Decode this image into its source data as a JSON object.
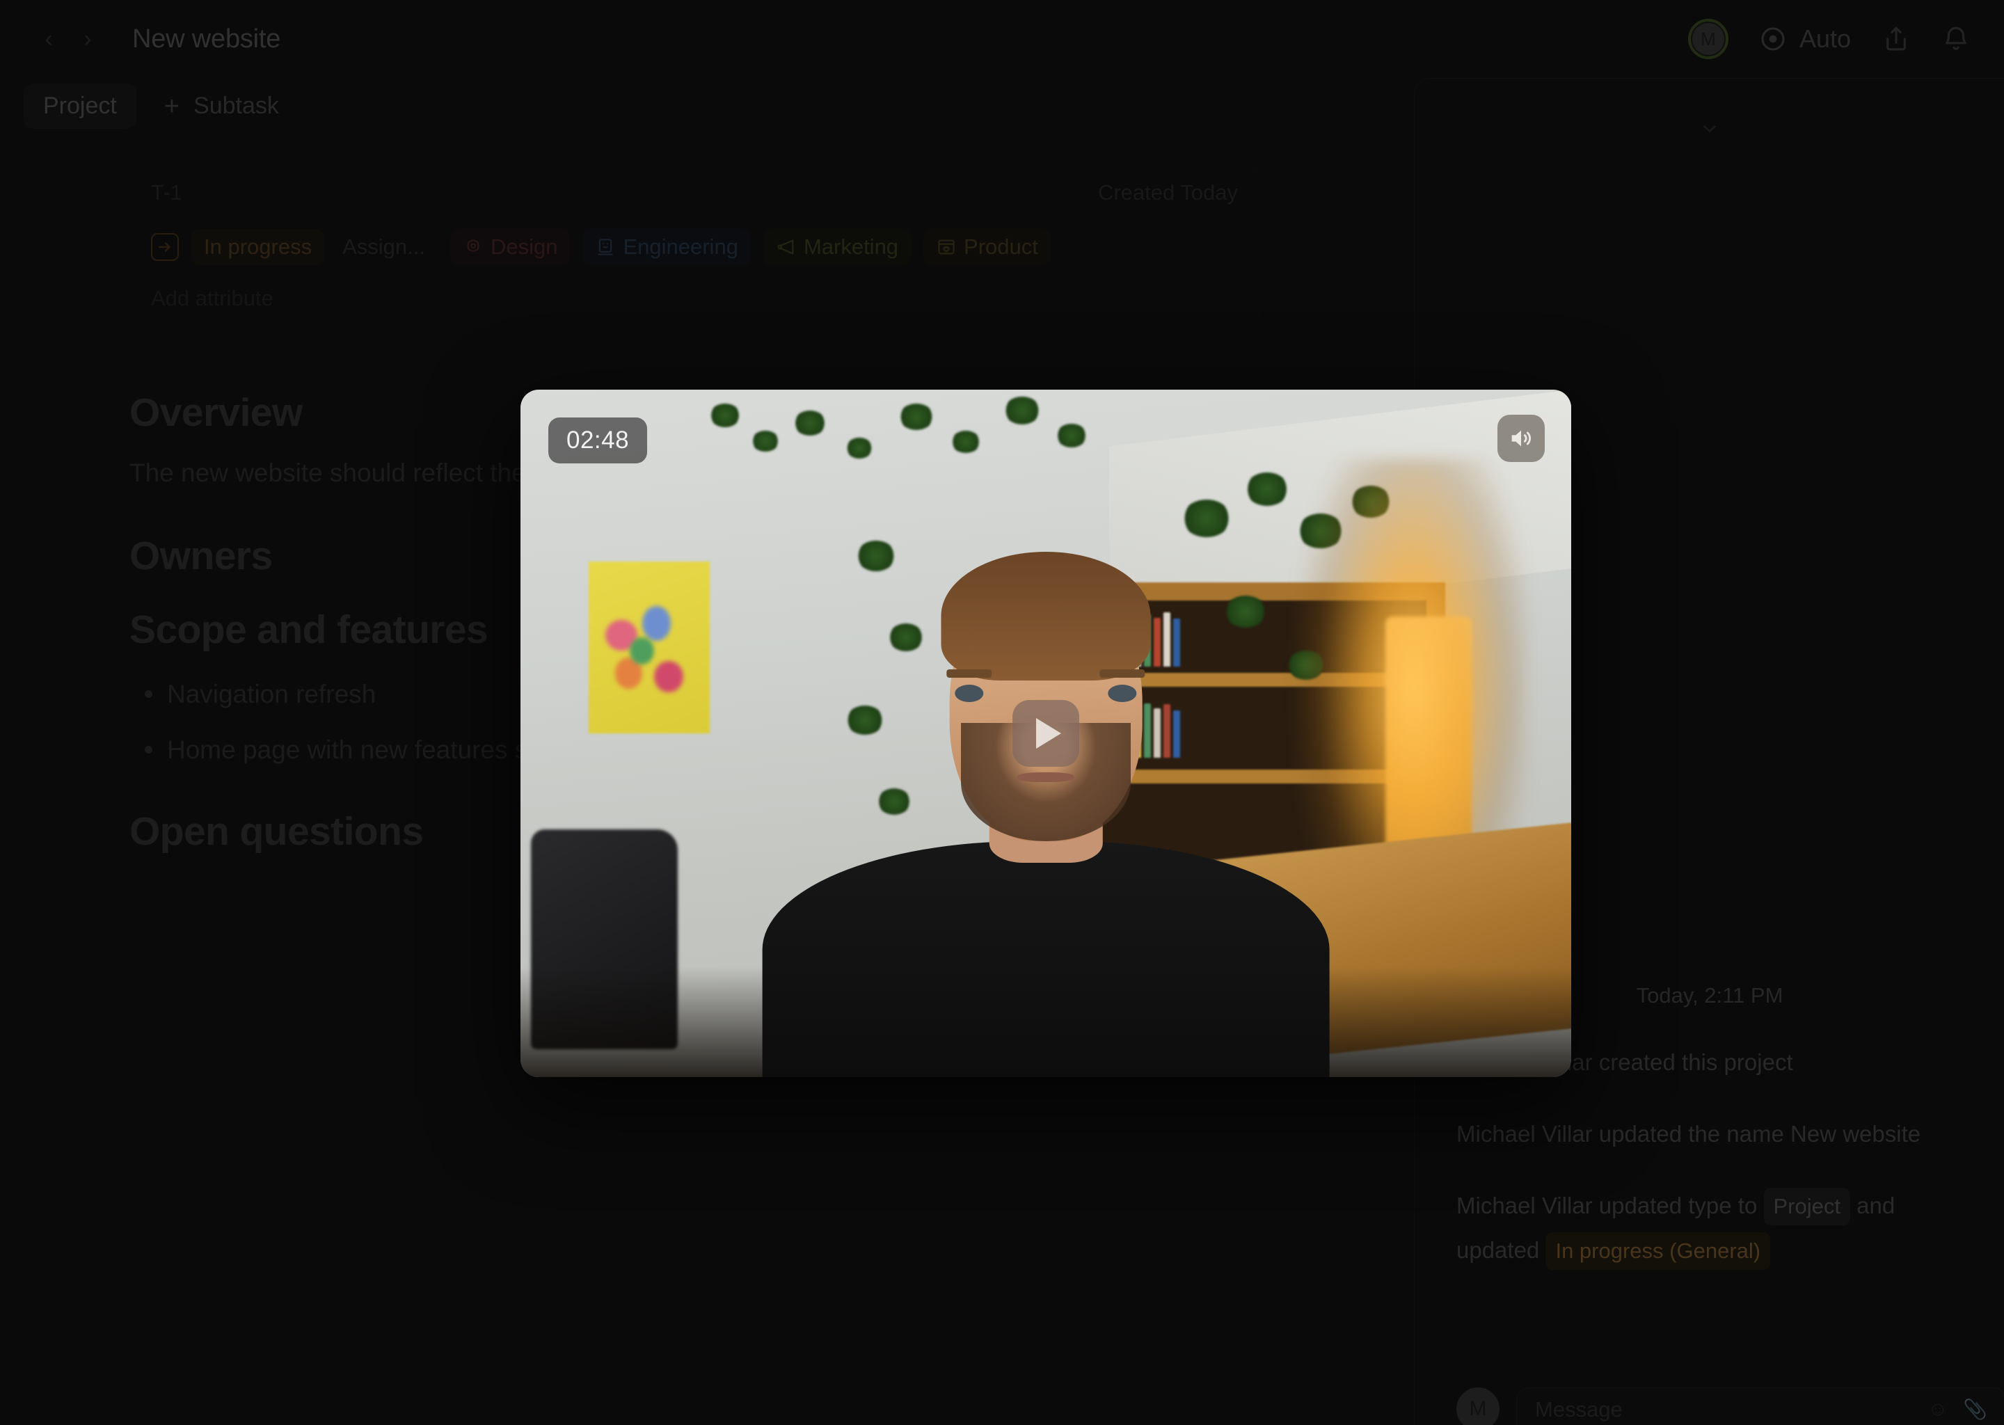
{
  "header": {
    "back_label": "‹",
    "forward_label": "›",
    "title": "New website",
    "auto_label": "Auto",
    "avatar_initial": "M"
  },
  "tabs": {
    "project_label": "Project",
    "add_symbol": "+",
    "subtask_label": "Subtask"
  },
  "attributes": {
    "id": "T-1",
    "created": "Created Today",
    "status": "In progress",
    "assignee_placeholder": "Assign...",
    "tags": [
      {
        "label": "Design",
        "icon": "flower-icon",
        "color": "#c05a60"
      },
      {
        "label": "Engineering",
        "icon": "laptop-icon",
        "color": "#5e8fc9"
      },
      {
        "label": "Marketing",
        "icon": "megaphone-icon",
        "color": "#92ad3f"
      },
      {
        "label": "Product",
        "icon": "window-heart-icon",
        "color": "#b79a3a"
      }
    ],
    "add_attribute": "Add attribute"
  },
  "document": {
    "overview_heading": "Overview",
    "overview_body": "The new website should reflect the company's updated branding.",
    "owners_heading": "Owners",
    "scope_heading": "Scope and features",
    "scope_items": [
      "Navigation refresh",
      "Home page with new features section"
    ],
    "open_questions_heading": "Open questions"
  },
  "video": {
    "elapsed": "02:48",
    "volume_icon": "speaker-on-icon",
    "play_icon": "play-icon"
  },
  "right_panel": {
    "collapse_icon": "chevron-down-icon",
    "activity_timestamp": "Today, 2:11 PM",
    "activity": [
      {
        "text": "Michael Villar created this project"
      },
      {
        "text": "Michael Villar updated the name New website"
      }
    ],
    "type_update": {
      "prefix": "Michael Villar updated type to",
      "chip_type": "Project",
      "middle": "and updated",
      "chip_status": "In progress (General)"
    },
    "composer": {
      "avatar_initial": "M",
      "placeholder": "Message",
      "emoji_icon": "emoji-icon",
      "attach_icon": "attachment-icon"
    }
  },
  "theme": {
    "background": "#0a0a0a",
    "panel": "#0c0c0c",
    "accent_green": "#5a7a2e",
    "status_orange": "#d89a46"
  }
}
